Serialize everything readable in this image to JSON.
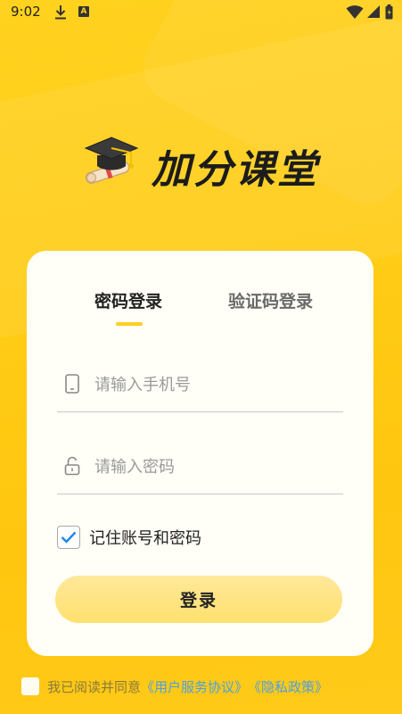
{
  "status_bar": {
    "time": "9:02",
    "a_badge": "A",
    "icons": [
      "download-icon",
      "a-notification-icon",
      "wifi-icon",
      "signal-icon",
      "battery-icon"
    ]
  },
  "logo": {
    "icon": "graduation-cap-icon",
    "title": "加分课堂"
  },
  "tabs": [
    {
      "label": "密码登录",
      "active": true
    },
    {
      "label": "验证码登录",
      "active": false
    }
  ],
  "form": {
    "phone": {
      "value": "",
      "placeholder": "请输入手机号",
      "icon": "phone-icon"
    },
    "password": {
      "value": "",
      "placeholder": "请输入密码",
      "icon": "lock-icon"
    },
    "remember": {
      "label": "记住账号和密码",
      "checked": true
    },
    "login_label": "登录"
  },
  "agreement": {
    "checked": false,
    "text": "我已阅读并同意",
    "user_agreement": "《用户服务协议》",
    "privacy_policy": "《隐私政策》"
  },
  "colors": {
    "background": "#ffcc16",
    "accent": "#ffcf1f",
    "button": "#ffe16e",
    "link": "#4ca0e0",
    "check": "#1e88e5"
  }
}
